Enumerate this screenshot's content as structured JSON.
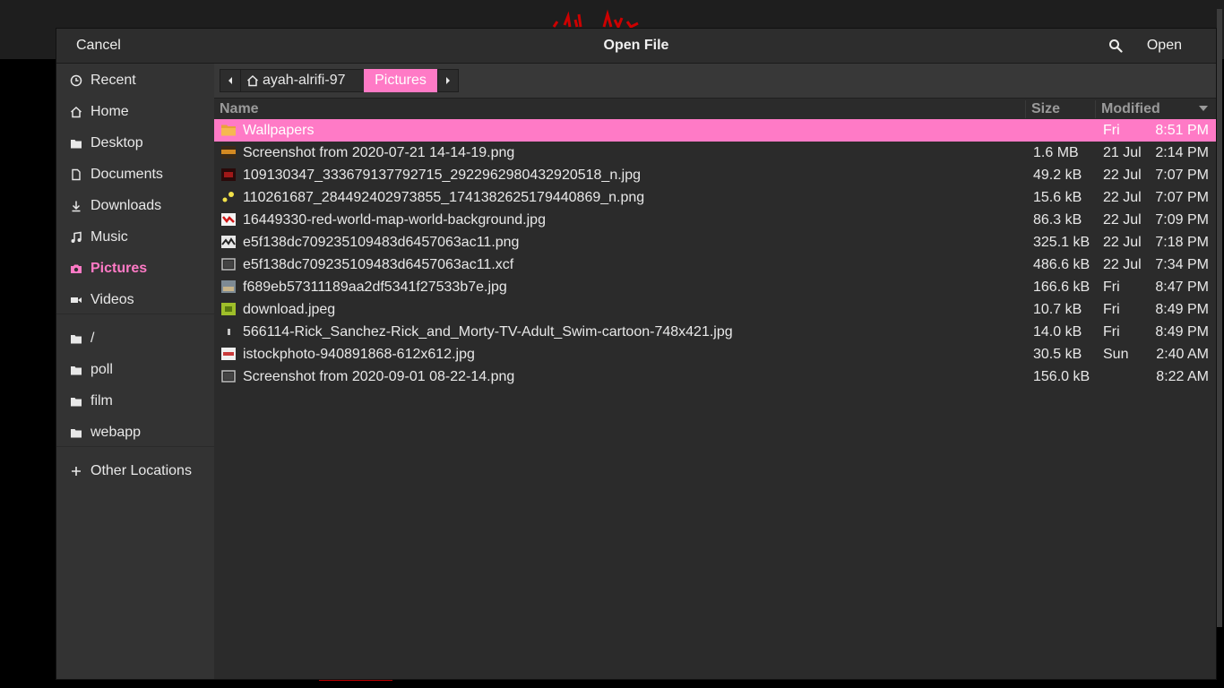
{
  "dialog": {
    "title": "Open File",
    "cancel_label": "Cancel",
    "open_label": "Open"
  },
  "sidebar": {
    "items": [
      {
        "label": "Recent",
        "icon": "clock-icon"
      },
      {
        "label": "Home",
        "icon": "home-icon"
      },
      {
        "label": "Desktop",
        "icon": "folder-icon"
      },
      {
        "label": "Documents",
        "icon": "document-icon"
      },
      {
        "label": "Downloads",
        "icon": "download-icon"
      },
      {
        "label": "Music",
        "icon": "music-icon"
      },
      {
        "label": "Pictures",
        "icon": "camera-icon"
      },
      {
        "label": "Videos",
        "icon": "video-icon"
      }
    ],
    "bookmarks": [
      {
        "label": "/",
        "icon": "folder-icon"
      },
      {
        "label": "poll",
        "icon": "folder-icon"
      },
      {
        "label": "film",
        "icon": "folder-icon"
      },
      {
        "label": "webapp",
        "icon": "folder-icon"
      }
    ],
    "other": {
      "label": "Other Locations",
      "icon": "plus-icon"
    }
  },
  "pathbar": {
    "home_label": "ayah-alrifi-97",
    "current_label": "Pictures"
  },
  "columns": {
    "name": "Name",
    "size": "Size",
    "modified": "Modified"
  },
  "files": [
    {
      "name": "Wallpapers",
      "size": "",
      "date": "Fri",
      "time": "8:51 PM",
      "icon": "folder-icon"
    },
    {
      "name": "Screenshot from 2020-07-21 14-14-19.png",
      "size": "1.6 MB",
      "date": "21 Jul",
      "time": "2:14 PM",
      "icon": "image-thumbnail-icon"
    },
    {
      "name": "109130347_333679137792715_2922962980432920518_n.jpg",
      "size": "49.2 kB",
      "date": "22 Jul",
      "time": "7:07 PM",
      "icon": "image-thumbnail-icon"
    },
    {
      "name": "110261687_284492402973855_1741382625179440869_n.png",
      "size": "15.6 kB",
      "date": "22 Jul",
      "time": "7:07 PM",
      "icon": "image-thumbnail-icon"
    },
    {
      "name": "16449330-red-world-map-world-background.jpg",
      "size": "86.3 kB",
      "date": "22 Jul",
      "time": "7:09 PM",
      "icon": "image-thumbnail-icon"
    },
    {
      "name": "e5f138dc709235109483d6457063ac11.png",
      "size": "325.1 kB",
      "date": "22 Jul",
      "time": "7:18 PM",
      "icon": "image-thumbnail-icon"
    },
    {
      "name": "e5f138dc709235109483d6457063ac11.xcf",
      "size": "486.6 kB",
      "date": "22 Jul",
      "time": "7:34 PM",
      "icon": "generic-file-icon"
    },
    {
      "name": "f689eb57311189aa2df5341f27533b7e.jpg",
      "size": "166.6 kB",
      "date": "Fri",
      "time": "8:47 PM",
      "icon": "image-thumbnail-icon"
    },
    {
      "name": "download.jpeg",
      "size": "10.7 kB",
      "date": "Fri",
      "time": "8:49 PM",
      "icon": "image-thumbnail-icon"
    },
    {
      "name": "566114-Rick_Sanchez-Rick_and_Morty-TV-Adult_Swim-cartoon-748x421.jpg",
      "size": "14.0 kB",
      "date": "Fri",
      "time": "8:49 PM",
      "icon": "image-thumbnail-icon"
    },
    {
      "name": "istockphoto-940891868-612x612.jpg",
      "size": "30.5 kB",
      "date": "Sun",
      "time": "2:40 AM",
      "icon": "image-thumbnail-icon"
    },
    {
      "name": "Screenshot from 2020-09-01 08-22-14.png",
      "size": "156.0 kB",
      "date": "",
      "time": "8:22 AM",
      "icon": "generic-file-icon"
    }
  ],
  "colors": {
    "accent": "#ff7ac6",
    "background": "#2b2b2b",
    "sidebar": "#333333"
  }
}
